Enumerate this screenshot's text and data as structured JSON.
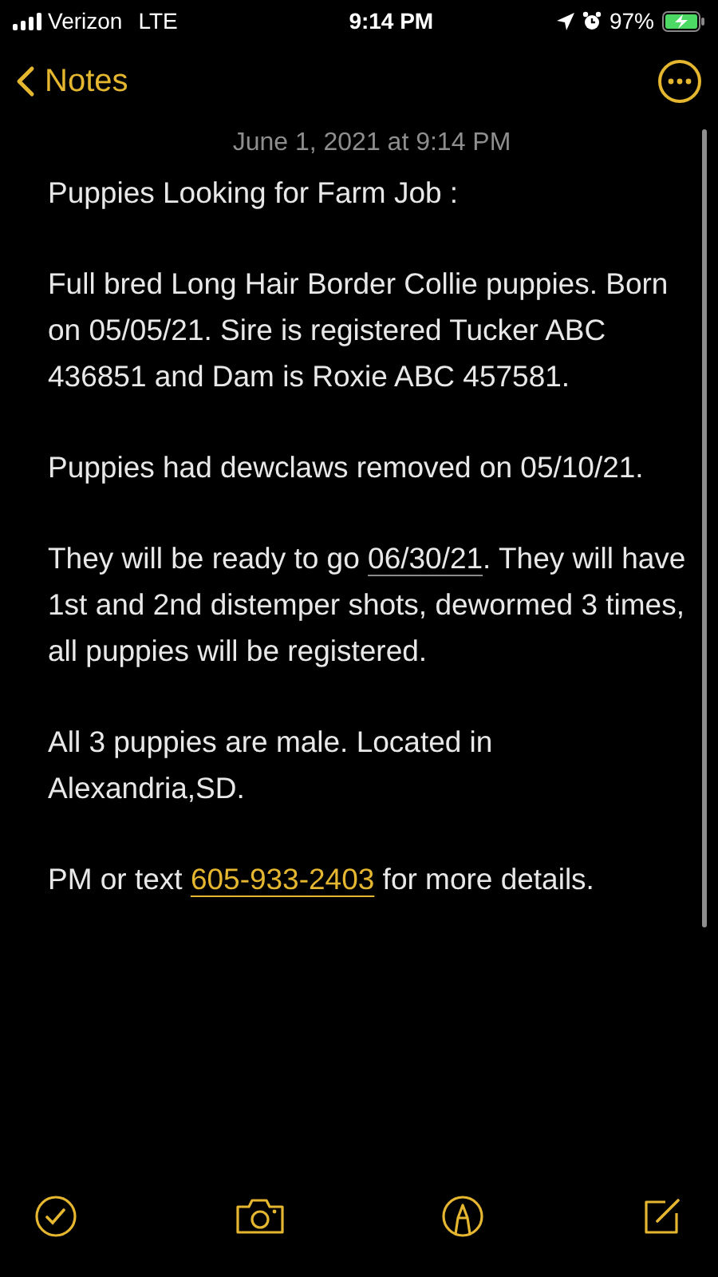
{
  "status_bar": {
    "carrier": "Verizon",
    "network": "LTE",
    "time": "9:14 PM",
    "battery": "97%"
  },
  "nav": {
    "back_label": "Notes"
  },
  "note": {
    "date": "June 1, 2021 at 9:14 PM",
    "paragraphs": [
      [
        {
          "kind": "text",
          "text": "Puppies Looking for Farm Job :"
        }
      ],
      [
        {
          "kind": "text",
          "text": "Full bred Long Hair Border Collie puppies. Born on 05/05/21. Sire is registered Tucker ABC 436851 and Dam is Roxie ABC 457581."
        }
      ],
      [
        {
          "kind": "text",
          "text": "Puppies had dewclaws removed on 05/10/21."
        }
      ],
      [
        {
          "kind": "text",
          "text": "They will be ready to go "
        },
        {
          "kind": "date",
          "text": "06/30/21"
        },
        {
          "kind": "text",
          "text": ". They will have 1st and 2nd distemper shots, dewormed 3 times, all puppies will be registered."
        }
      ],
      [
        {
          "kind": "text",
          "text": "All 3 puppies are male. Located in Alexandria,SD."
        }
      ],
      [
        {
          "kind": "text",
          "text": "PM or text "
        },
        {
          "kind": "phone",
          "text": "605-933-2403"
        },
        {
          "kind": "text",
          "text": " for more details."
        }
      ]
    ]
  }
}
